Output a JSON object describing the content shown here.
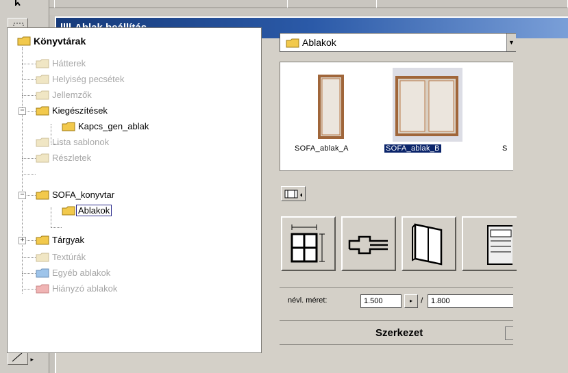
{
  "dialog": {
    "title": "Ablak beállítás"
  },
  "tree": {
    "root_label": "Könyvtárak",
    "items": [
      {
        "label": "Hátterek"
      },
      {
        "label": "Helyiség pecsétek"
      },
      {
        "label": "Jellemzők"
      },
      {
        "label": "Kiegészítések"
      },
      {
        "label": "Kapcs_gen_ablak"
      },
      {
        "label": "Lista sablonok"
      },
      {
        "label": "Részletek"
      },
      {
        "label": "SOFA_konyvtar"
      },
      {
        "label": "Ablakok"
      },
      {
        "label": "Tárgyak"
      },
      {
        "label": "Textúrák"
      },
      {
        "label": "Egyéb ablakok"
      },
      {
        "label": "Hiányzó ablakok"
      }
    ]
  },
  "library_select": {
    "value": "Ablakok"
  },
  "gallery": {
    "items": [
      {
        "label": "SOFA_ablak_A"
      },
      {
        "label": "SOFA_ablak_B"
      },
      {
        "label": "S"
      }
    ]
  },
  "params": {
    "size_label": "névl. méret:",
    "width_value": "1.500",
    "height_value": "1.800",
    "separator": "/",
    "section_title": "Szerkezet"
  },
  "colors": {
    "titlebar": "#163a7a",
    "selection": "#0a246a",
    "folder": "#f2c94c"
  }
}
